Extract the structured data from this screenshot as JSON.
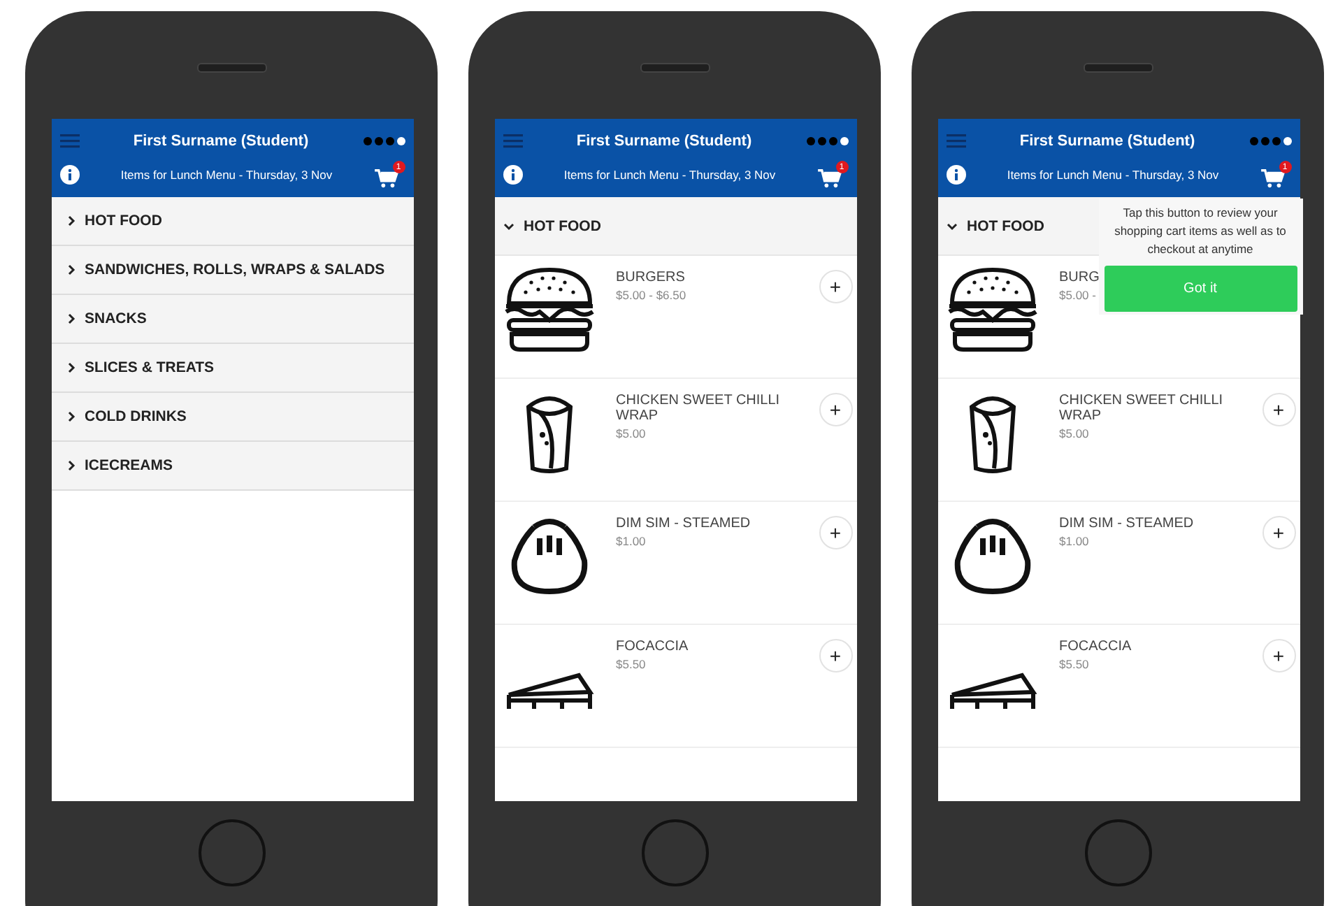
{
  "phones": [
    {
      "kind": "categories",
      "header": {
        "title": "First Surname (Student)",
        "subtitle": "Items for Lunch Menu - Thursday, 3 Nov",
        "cart_count": "1",
        "page_dots": [
          {
            "selected": false
          },
          {
            "selected": false
          },
          {
            "selected": false
          },
          {
            "selected": true
          }
        ]
      },
      "categories": [
        {
          "label": "HOT FOOD",
          "expanded": false
        },
        {
          "label": "SANDWICHES, ROLLS, WRAPS & SALADS",
          "expanded": false
        },
        {
          "label": "SNACKS",
          "expanded": false
        },
        {
          "label": "SLICES & TREATS",
          "expanded": false
        },
        {
          "label": "COLD DRINKS",
          "expanded": false
        },
        {
          "label": "ICECREAMS",
          "expanded": false
        }
      ]
    },
    {
      "kind": "items",
      "header": {
        "title": "First Surname (Student)",
        "subtitle": "Items for Lunch Menu - Thursday, 3 Nov",
        "cart_count": "1",
        "page_dots": [
          {
            "selected": false
          },
          {
            "selected": false
          },
          {
            "selected": false
          },
          {
            "selected": true
          }
        ]
      },
      "section": {
        "label": "HOT FOOD",
        "expanded": true
      },
      "items": [
        {
          "kind": "burger",
          "name": "BURGERS",
          "price": "$5.00 - $6.50",
          "add": "+"
        },
        {
          "kind": "wrap",
          "name": "CHICKEN SWEET CHILLI WRAP",
          "price": "$5.00",
          "add": "+"
        },
        {
          "kind": "dumpling",
          "name": "DIM SIM - STEAMED",
          "price": "$1.00",
          "add": "+"
        },
        {
          "kind": "sandwich",
          "name": "FOCACCIA",
          "price": "$5.50",
          "add": "+"
        }
      ]
    },
    {
      "kind": "items",
      "header": {
        "title": "First Surname (Student)",
        "subtitle": "Items for Lunch Menu - Thursday, 3 Nov",
        "cart_count": "1",
        "page_dots": [
          {
            "selected": false
          },
          {
            "selected": false
          },
          {
            "selected": false
          },
          {
            "selected": true
          }
        ]
      },
      "section": {
        "label": "HOT FOOD",
        "expanded": true
      },
      "items": [
        {
          "kind": "burger",
          "name": "BURG",
          "price": "$5.00 -"
        },
        {
          "kind": "wrap",
          "name": "CHICKEN SWEET CHILLI WRAP",
          "price": "$5.00",
          "add": "+"
        },
        {
          "kind": "dumpling",
          "name": "DIM SIM - STEAMED",
          "price": "$1.00",
          "add": "+"
        },
        {
          "kind": "sandwich",
          "name": "FOCACCIA",
          "price": "$5.50",
          "add": "+"
        }
      ],
      "tooltip": {
        "text": "Tap this button to review your shopping cart items as well as to checkout at anytime",
        "button": "Got it"
      }
    }
  ]
}
